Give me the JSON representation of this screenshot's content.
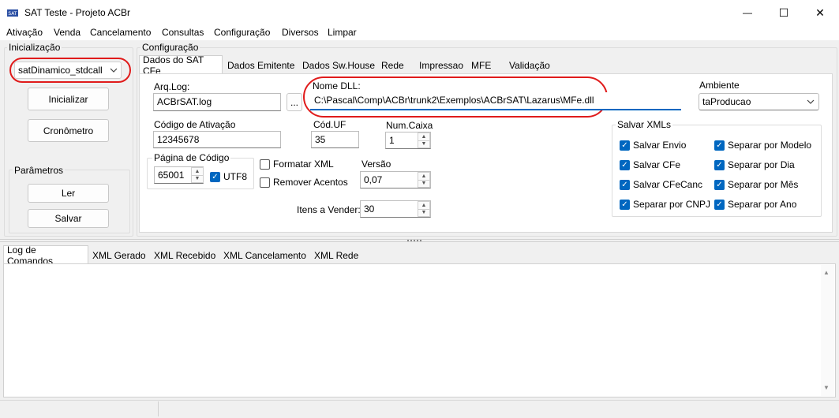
{
  "window": {
    "title": "SAT Teste - Projeto ACBr",
    "minimize_glyph": "—",
    "maximize_glyph": "☐",
    "close_glyph": "✕"
  },
  "menu": [
    "Ativação",
    "Venda",
    "Cancelamento",
    "Consultas",
    "Configuração",
    "Diversos",
    "Limpar"
  ],
  "left_panel": {
    "group_label": "Inicialização",
    "model_select": "satDinamico_stdcall",
    "init_button": "Inicializar",
    "chrono_button": "Cronômetro",
    "params_label": "Parâmetros",
    "read_button": "Ler",
    "save_button": "Salvar"
  },
  "config": {
    "group_label": "Configuração",
    "tabs": [
      "Dados do SAT CFe",
      "Dados Emitente",
      "Dados Sw.House",
      "Rede",
      "Impressao",
      "MFE",
      "Validação"
    ],
    "arq_log_label": "Arq.Log:",
    "arq_log_value": "ACBrSAT.log",
    "browse_label": "...",
    "dll_label": "Nome DLL:",
    "dll_value": "C:\\Pascal\\Comp\\ACBr\\trunk2\\Exemplos\\ACBrSAT\\Lazarus\\MFe.dll",
    "ambiente_label": "Ambiente",
    "ambiente_value": "taProducao",
    "cod_ativacao_label": "Código de Ativação",
    "cod_ativacao_value": "12345678",
    "cod_uf_label": "Cód.UF",
    "cod_uf_value": "35",
    "num_caixa_label": "Num.Caixa",
    "num_caixa_value": "1",
    "pagina_label": "Página de Código",
    "pagina_value": "65001",
    "utf8_label": "UTF8",
    "formatar_xml_label": "Formatar XML",
    "remover_acentos_label": "Remover Acentos",
    "versao_label": "Versão",
    "versao_value": "0,07",
    "itens_label": "Itens a Vender:",
    "itens_value": "30",
    "salvar_xmls_label": "Salvar XMLs",
    "salvar_envio": "Salvar Envio",
    "salvar_cfe": "Salvar CFe",
    "salvar_cfecanc": "Salvar CFeCanc",
    "separar_cnpj": "Separar por CNPJ",
    "separar_modelo": "Separar por Modelo",
    "separar_dia": "Separar por Dia",
    "separar_mes": "Separar por Mês",
    "separar_ano": "Separar por Ano"
  },
  "log_tabs": [
    "Log de Comandos",
    "XML Gerado",
    "XML Recebido",
    "XML Cancelamento",
    "XML Rede"
  ],
  "colors": {
    "accent": "#0067c0",
    "highlight": "#e01b1b"
  }
}
